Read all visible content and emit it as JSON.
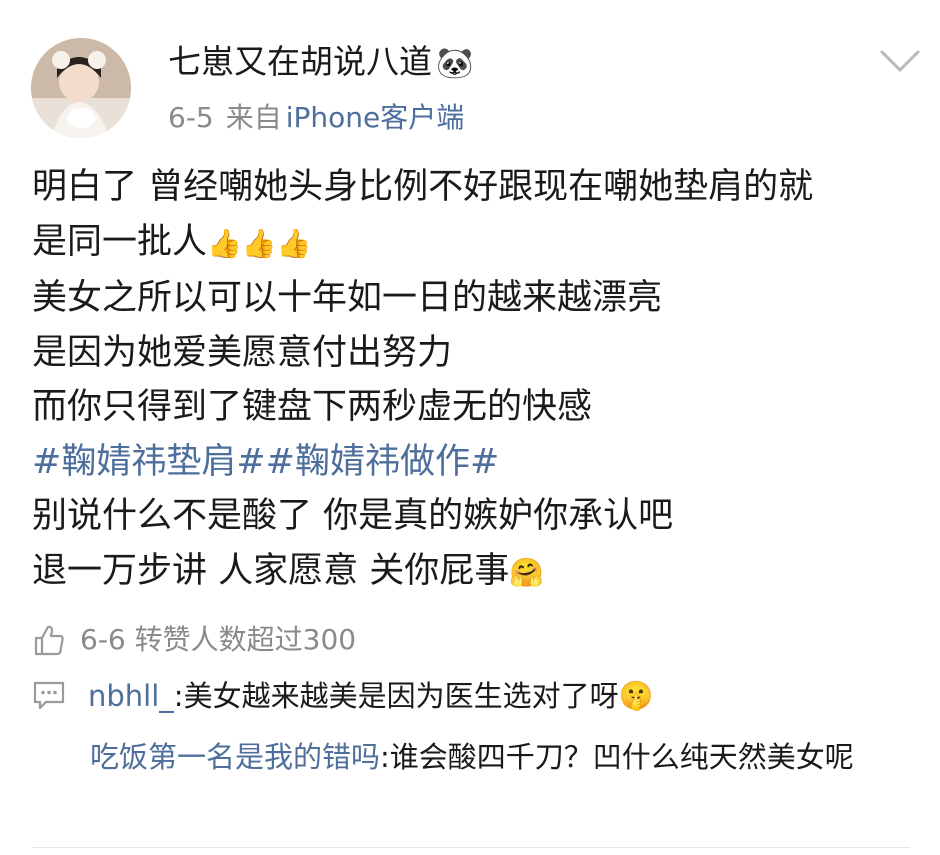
{
  "post": {
    "username": "七崽又在胡说八道",
    "username_emoji": "🐼",
    "date": "6-5",
    "from_label": "来自",
    "source": "iPhone客户端",
    "lines": [
      {
        "text": "明白了 曾经嘲她头身比例不好跟现在嘲她垫肩的就"
      },
      {
        "text": "是同一批人",
        "emoji": "👍👍👍"
      },
      {
        "text": "美女之所以可以十年如一日的越来越漂亮"
      },
      {
        "text": "是因为她爱美愿意付出努力"
      },
      {
        "text": "而你只得到了键盘下两秒虚无的快感"
      },
      {
        "hashtags": "#鞠婧祎垫肩##鞠婧祎做作#"
      },
      {
        "text": "别说什么不是酸了 你是真的嫉妒你承认吧"
      },
      {
        "text": "退一万步讲 人家愿意 关你屁事",
        "emoji": "🤗"
      }
    ]
  },
  "like_row": {
    "icon": "thumbs-up-icon",
    "text": "6-6 转赞人数超过300"
  },
  "comments": [
    {
      "icon": "comment-icon",
      "user": "nbhll_",
      "text": ":美女越来越美是因为医生选对了呀",
      "emoji": "🤫"
    },
    {
      "user": "吃饭第一名是我的错吗",
      "text": ":谁会酸四千刀？凹什么纯天然美女呢"
    }
  ],
  "colors": {
    "link": "#4e6e9c",
    "meta": "#8a8a8a",
    "text": "#1a1a1a"
  }
}
